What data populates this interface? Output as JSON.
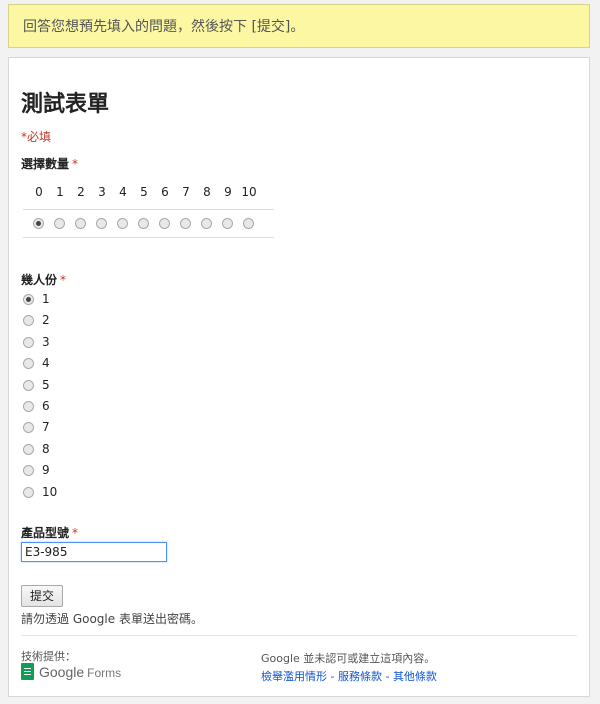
{
  "banner": {
    "text": "回答您想預先填入的問題，然後按下 [提交]。"
  },
  "form": {
    "title": "測試表單",
    "required_note": "*必填"
  },
  "questions": {
    "quantity": {
      "label": "選擇數量",
      "required_mark": "*",
      "scale": [
        "0",
        "1",
        "2",
        "3",
        "4",
        "5",
        "6",
        "7",
        "8",
        "9",
        "10"
      ],
      "selected": "0"
    },
    "people": {
      "label": "幾人份",
      "required_mark": "*",
      "options": [
        "1",
        "2",
        "3",
        "4",
        "5",
        "6",
        "7",
        "8",
        "9",
        "10"
      ],
      "selected": "1"
    },
    "product": {
      "label": "產品型號",
      "required_mark": "*",
      "value": "E3-985"
    }
  },
  "submit": {
    "label": "提交"
  },
  "password_warning": "請勿透過 Google 表單送出密碼。",
  "footer": {
    "powered_by": "技術提供：",
    "brand_google": "Google",
    "brand_forms": "Forms",
    "disclaimer": "Google 並未認可或建立這項內容。",
    "links": [
      "檢舉濫用情形",
      "服務條款",
      "其他條款"
    ],
    "link_separator": " - "
  }
}
